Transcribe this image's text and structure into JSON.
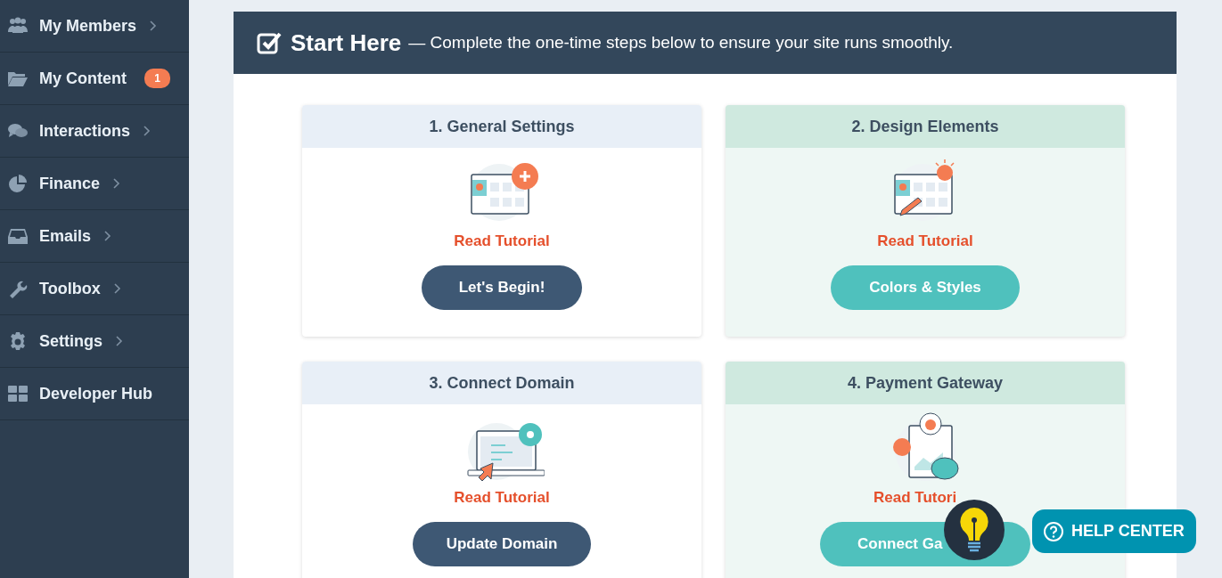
{
  "sidebar": {
    "items": [
      {
        "label": "My Members",
        "chevron": true
      },
      {
        "label": "My Content",
        "chevron": false,
        "badge": "1"
      },
      {
        "label": "Interactions",
        "chevron": true
      },
      {
        "label": "Finance",
        "chevron": true
      },
      {
        "label": "Emails",
        "chevron": true
      },
      {
        "label": "Toolbox",
        "chevron": true
      },
      {
        "label": "Settings",
        "chevron": true
      },
      {
        "label": "Developer Hub",
        "chevron": false
      }
    ]
  },
  "panel": {
    "title": "Start Here",
    "subtitle": "— Complete the one-time steps below to ensure your site runs smoothly.",
    "steps": [
      {
        "title": "1. General Settings",
        "kind": "primary",
        "link": "Read Tutorial",
        "button": "Let's Begin!",
        "covered": false
      },
      {
        "title": "2. Design Elements",
        "kind": "accent",
        "link": "Read Tutorial",
        "button": "Colors & Styles",
        "covered": false
      },
      {
        "title": "3. Connect Domain",
        "kind": "primary",
        "link": "Read Tutorial",
        "button": "Update Domain",
        "covered": false
      },
      {
        "title": "4. Payment Gateway",
        "kind": "accent",
        "link": "Read Tutori",
        "button": "Connect Ga",
        "covered": true
      }
    ]
  },
  "help": {
    "label": "HELP CENTER"
  }
}
